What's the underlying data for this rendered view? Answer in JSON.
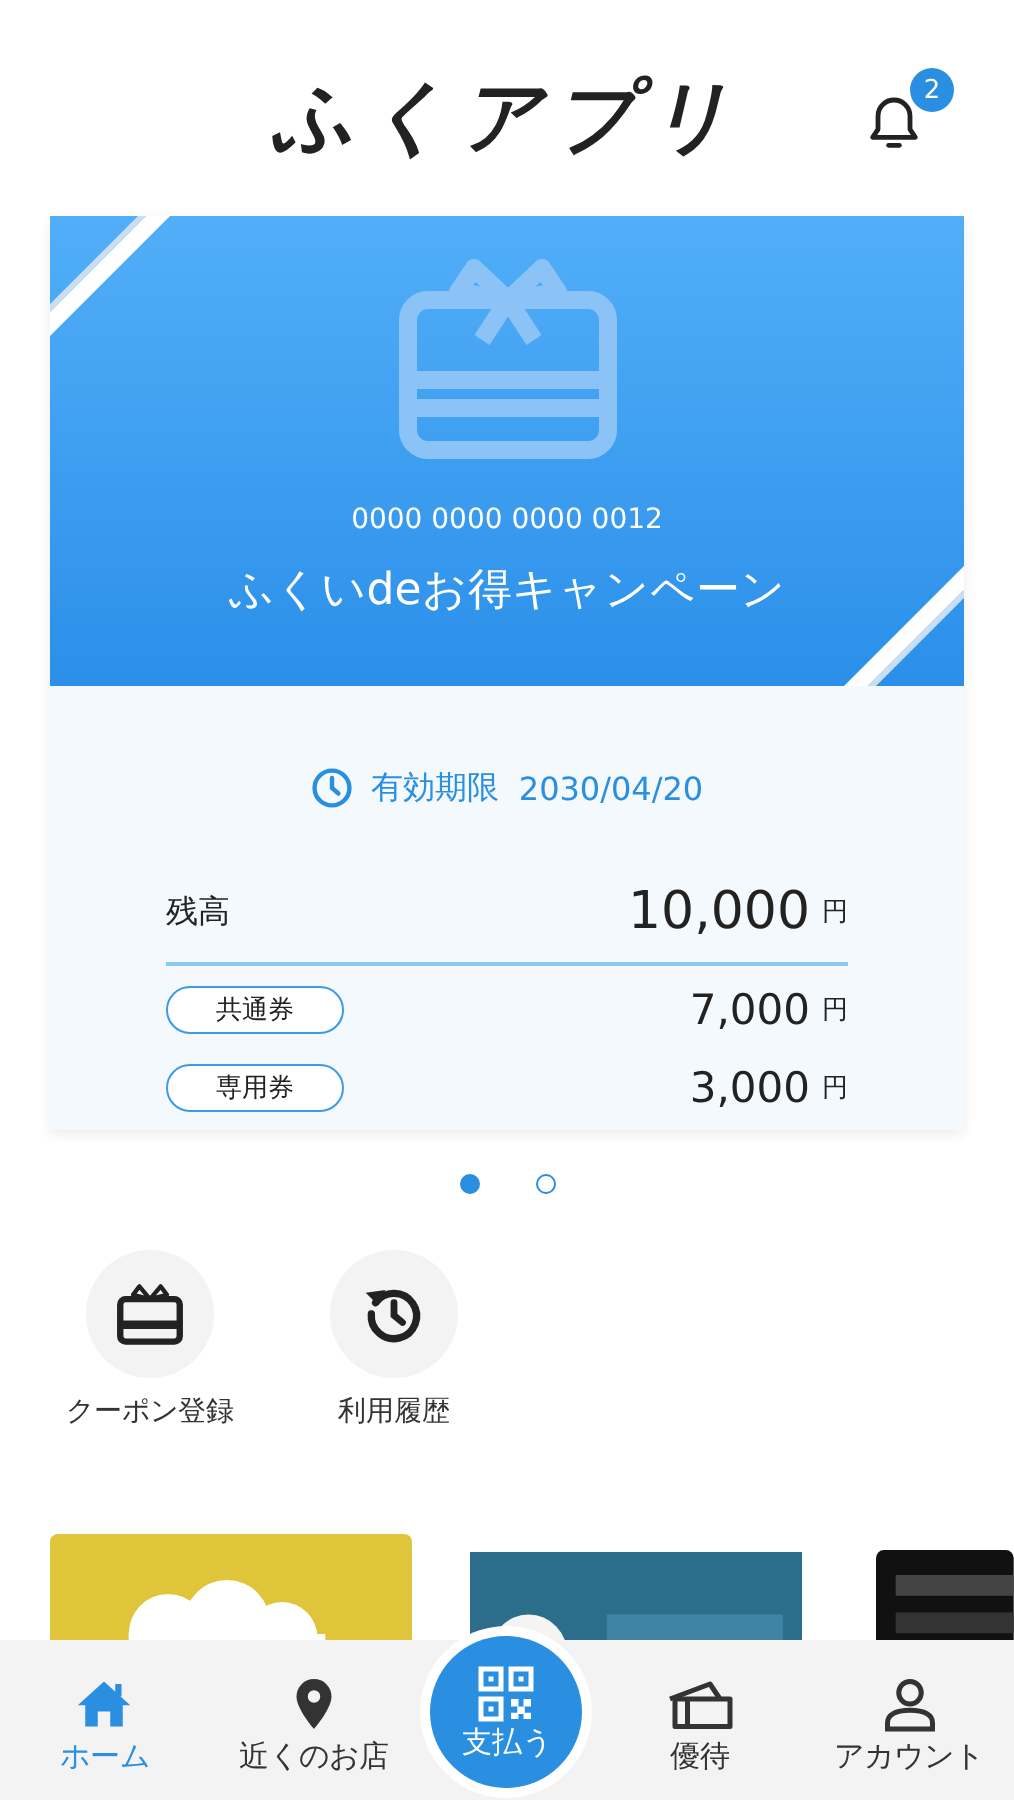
{
  "header": {
    "title": "ふくアプリ",
    "notification_count": "2"
  },
  "card": {
    "number": "0000 0000 0000 0012",
    "name": "ふくいdeお得キャンペーン",
    "expiry_label": "有効期限",
    "expiry_date": "2030/04/20",
    "balance": {
      "label": "残高",
      "amount": "10,000",
      "unit": "円"
    },
    "breakdown": [
      {
        "label": "共通券",
        "amount": "7,000",
        "unit": "円"
      },
      {
        "label": "専用券",
        "amount": "3,000",
        "unit": "円"
      }
    ]
  },
  "pager": [
    {
      "selected": true
    },
    {
      "selected": false
    }
  ],
  "shortcuts": [
    {
      "kind": "coupon",
      "label": "クーポン登録"
    },
    {
      "kind": "history",
      "label": "利用履歴"
    }
  ],
  "nav": [
    {
      "kind": "home",
      "label": "ホーム",
      "selected": true
    },
    {
      "kind": "pin",
      "label": "近くのお店",
      "selected": false
    },
    {
      "kind": "qr",
      "label": "支払う",
      "selected": false
    },
    {
      "kind": "ticket",
      "label": "優待",
      "selected": false
    },
    {
      "kind": "person",
      "label": "アカウント",
      "selected": false
    }
  ]
}
